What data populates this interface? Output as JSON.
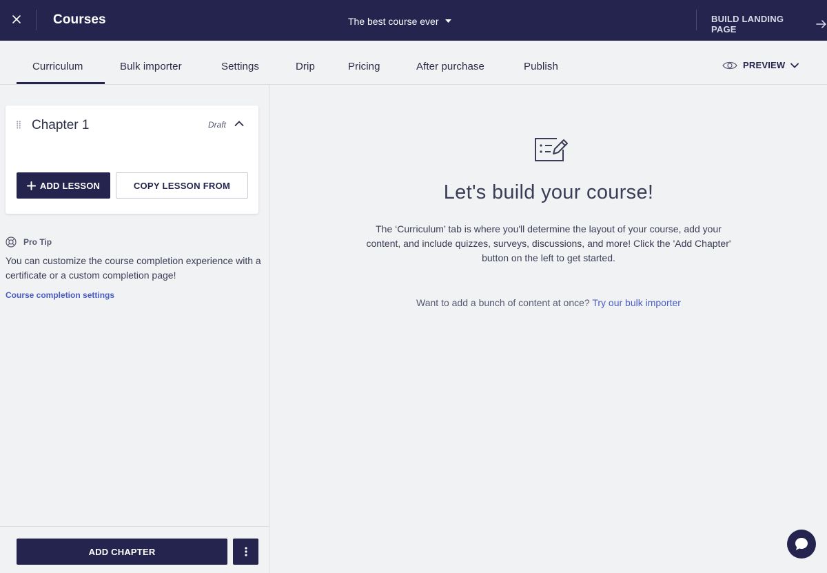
{
  "topbar": {
    "title": "Courses",
    "course_selector": "The best course ever",
    "build_landing": "BUILD LANDING PAGE"
  },
  "tabs": [
    {
      "label": "Curriculum",
      "active": true
    },
    {
      "label": "Bulk importer"
    },
    {
      "label": "Settings"
    },
    {
      "label": "Drip"
    },
    {
      "label": "Pricing"
    },
    {
      "label": "After purchase"
    },
    {
      "label": "Publish"
    }
  ],
  "preview_label": "PREVIEW",
  "sidebar": {
    "chapter": {
      "title": "Chapter 1",
      "status": "Draft",
      "add_lesson_label": "ADD LESSON",
      "copy_lesson_label": "COPY LESSON FROM"
    },
    "protip": {
      "heading": "Pro Tip",
      "text": "You can customize the course completion experience with a certificate or a custom completion page!",
      "link": "Course completion settings"
    },
    "add_chapter_label": "ADD CHAPTER"
  },
  "main": {
    "heading": "Let's build your course!",
    "description": "The ‘Curriculum’ tab is where you'll determine the layout of your course, add your content, and include quizzes, surveys, discussions, and more! Click the 'Add Chapter' button on the left to get started.",
    "bulk_prompt": "Want to add a bunch of content at once?",
    "bulk_link": "Try our bulk importer"
  },
  "colors": {
    "brand": "#24244f",
    "link": "#4a5cc4",
    "background": "#f1f2f4"
  }
}
